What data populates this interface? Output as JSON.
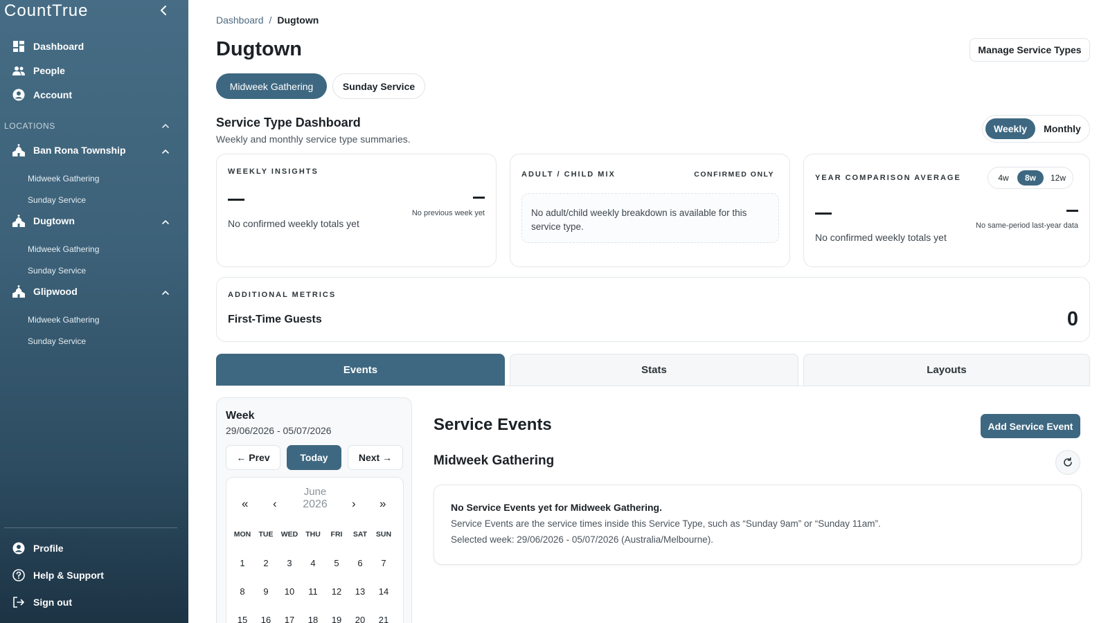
{
  "app": {
    "brand": "CountTrue"
  },
  "sidebar": {
    "nav": [
      {
        "label": "Dashboard",
        "icon": "dashboard-icon"
      },
      {
        "label": "People",
        "icon": "people-icon"
      },
      {
        "label": "Account",
        "icon": "account-icon"
      }
    ],
    "section_label": "LOCATIONS",
    "locations": [
      {
        "name": "Ban Rona Township",
        "items": [
          "Midweek Gathering",
          "Sunday Service"
        ]
      },
      {
        "name": "Dugtown",
        "items": [
          "Midweek Gathering",
          "Sunday Service"
        ]
      },
      {
        "name": "Glipwood",
        "items": [
          "Midweek Gathering",
          "Sunday Service"
        ]
      }
    ],
    "footer": [
      {
        "label": "Profile",
        "icon": "profile-icon"
      },
      {
        "label": "Help & Support",
        "icon": "help-icon"
      },
      {
        "label": "Sign out",
        "icon": "sign-out-icon"
      }
    ]
  },
  "breadcrumb": {
    "root": "Dashboard",
    "sep": "/",
    "current": "Dugtown"
  },
  "page": {
    "title": "Dugtown",
    "manage_label": "Manage Service Types"
  },
  "service_tabs": [
    "Midweek Gathering",
    "Sunday Service"
  ],
  "dashboard": {
    "title": "Service Type Dashboard",
    "subtitle": "Weekly and monthly service type summaries.",
    "period": [
      "Weekly",
      "Monthly"
    ]
  },
  "cards": {
    "weekly": {
      "label": "WEEKLY INSIGHTS",
      "empty": "No confirmed weekly totals yet",
      "prev": "No previous week yet"
    },
    "mix": {
      "label": "ADULT / CHILD MIX",
      "badge": "CONFIRMED ONLY",
      "note": "No adult/child weekly breakdown is available for this service type."
    },
    "year": {
      "label": "YEAR COMPARISON AVERAGE",
      "ranges": [
        "4w",
        "8w",
        "12w"
      ],
      "empty": "No confirmed weekly totals yet",
      "last_year": "No same-period last-year data"
    },
    "additional": {
      "label": "ADDITIONAL METRICS",
      "metric": "First-Time Guests",
      "value": "0"
    }
  },
  "content_tabs": [
    "Events",
    "Stats",
    "Layouts"
  ],
  "week": {
    "title": "Week",
    "range": "29/06/2026 - 05/07/2026",
    "prev": "← Prev",
    "today": "Today",
    "next": "Next →",
    "nav": {
      "first": "«",
      "back": "‹",
      "fwd": "›",
      "last": "»"
    },
    "month": "June",
    "year": "2026",
    "weekdays": [
      "MON",
      "TUE",
      "WED",
      "THU",
      "FRI",
      "SAT",
      "SUN"
    ],
    "rows": [
      [
        "1",
        "2",
        "3",
        "4",
        "5",
        "6",
        "7"
      ],
      [
        "8",
        "9",
        "10",
        "11",
        "12",
        "13",
        "14"
      ],
      [
        "15",
        "16",
        "17",
        "18",
        "19",
        "20",
        "21"
      ]
    ]
  },
  "events": {
    "title": "Service Events",
    "add_label": "Add Service Event",
    "subtitle": "Midweek Gathering",
    "empty_title": "No Service Events yet for Midweek Gathering.",
    "empty_desc": "Service Events are the service times inside this Service Type, such as “Sunday 9am” or “Sunday 11am”.",
    "empty_week": "Selected week: 29/06/2026 - 05/07/2026 (Australia/Melbourne)."
  },
  "colors": {
    "accent": "#3e6881",
    "sidebar_top": "#466d85",
    "sidebar_bottom": "#1c3344"
  }
}
